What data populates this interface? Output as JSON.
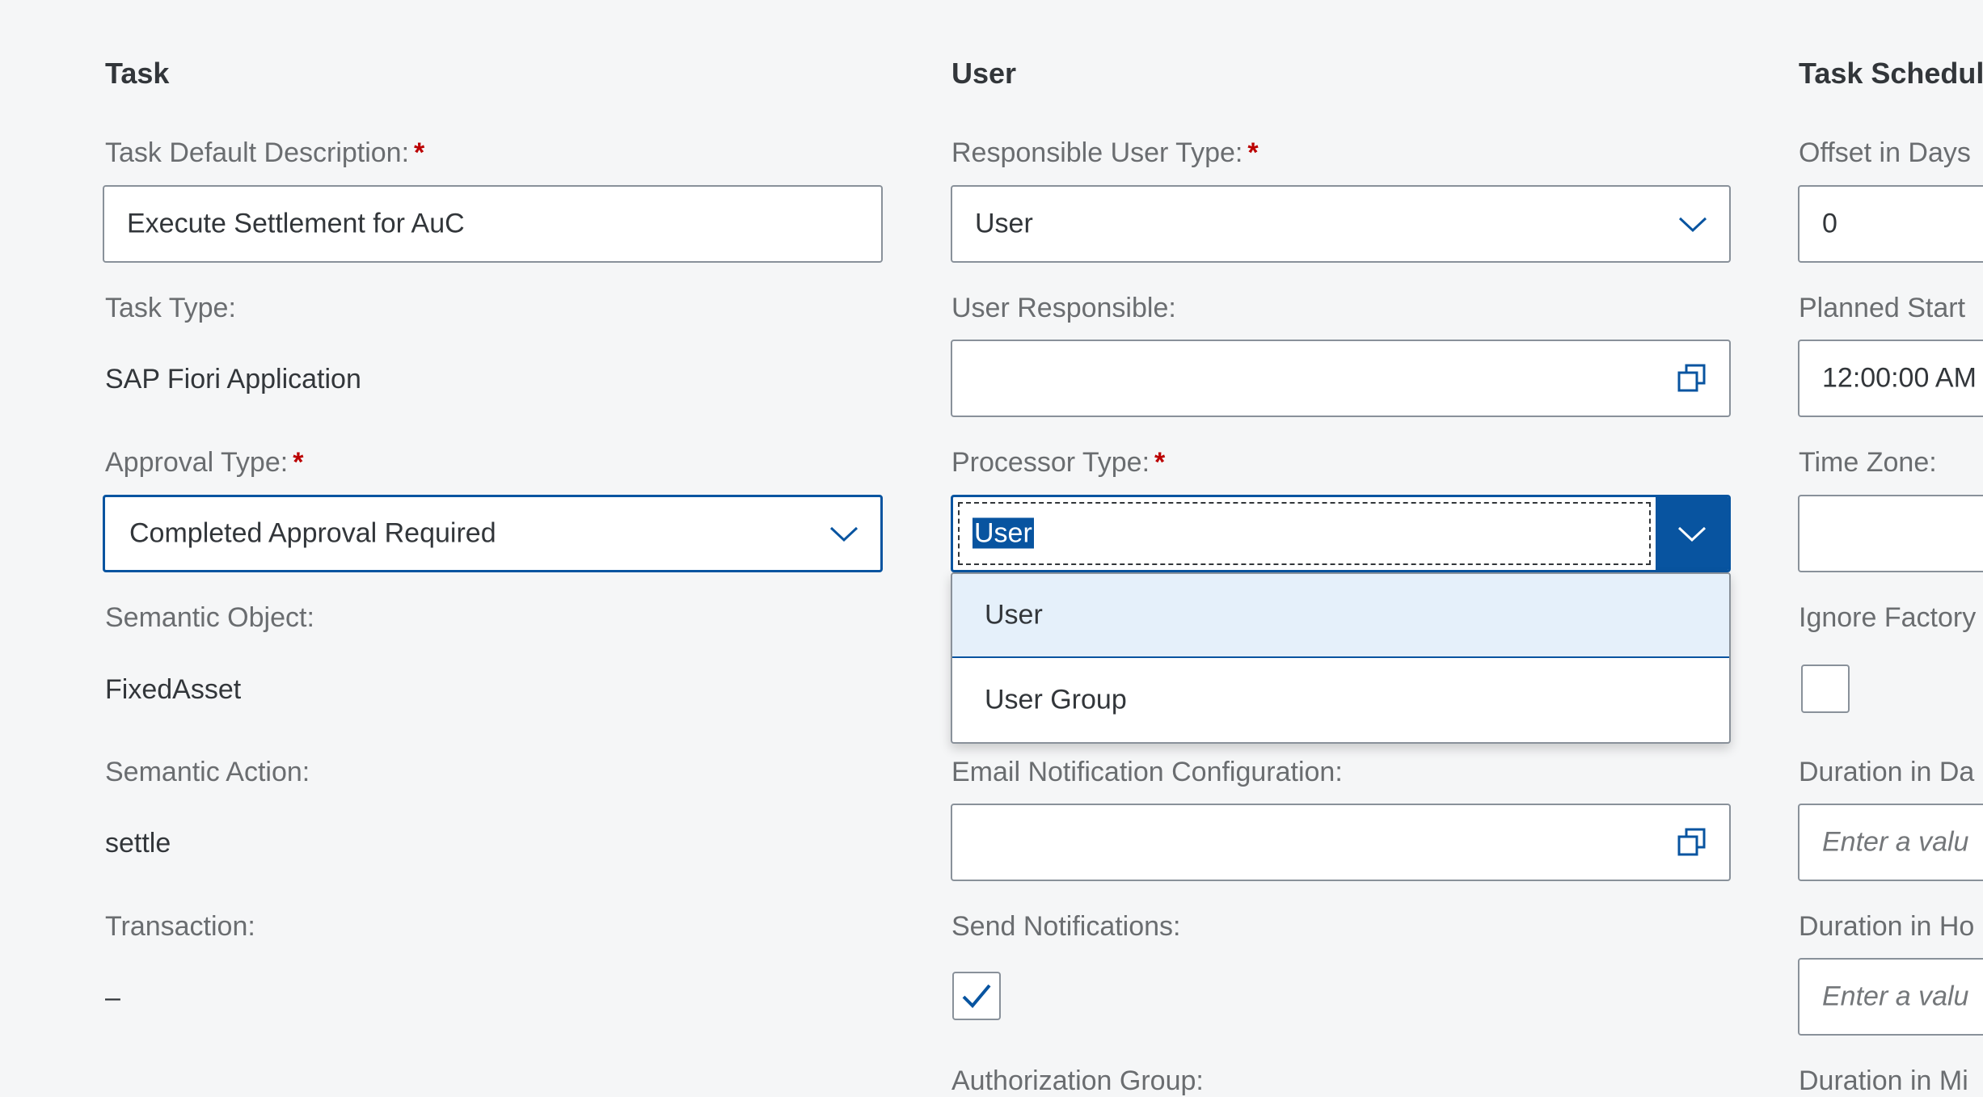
{
  "task_column": {
    "title": "Task",
    "default_description_label": "Task Default Description:",
    "default_description_value": "Execute Settlement for AuC",
    "task_type_label": "Task Type:",
    "task_type_value": "SAP Fiori Application",
    "approval_type_label": "Approval Type:",
    "approval_type_value": "Completed Approval Required",
    "semantic_object_label": "Semantic Object:",
    "semantic_object_value": "FixedAsset",
    "semantic_action_label": "Semantic Action:",
    "semantic_action_value": "settle",
    "transaction_label": "Transaction:",
    "transaction_value": "–"
  },
  "user_column": {
    "title": "User",
    "responsible_user_type_label": "Responsible User Type:",
    "responsible_user_type_value": "User",
    "user_responsible_label": "User Responsible:",
    "user_responsible_value": "",
    "processor_type_label": "Processor Type:",
    "processor_type_value": "User",
    "processor_type_options": [
      "User",
      "User Group"
    ],
    "email_notification_label": "Email Notification Configuration:",
    "email_notification_value": "",
    "send_notifications_label": "Send Notifications:",
    "send_notifications_checked": true,
    "authorization_group_label": "Authorization Group:"
  },
  "schedule_column": {
    "title": "Task Schedul",
    "offset_label": "Offset in Days",
    "offset_value": "0",
    "planned_start_label": "Planned Start",
    "planned_start_value": "12:00:00 AM",
    "time_zone_label": "Time Zone:",
    "time_zone_value": "",
    "ignore_factory_label": "Ignore Factory",
    "ignore_factory_checked": false,
    "duration_days_label": "Duration in Da",
    "duration_days_placeholder": "Enter a valu",
    "duration_hours_label": "Duration in Ho",
    "duration_hours_placeholder": "Enter a valu",
    "duration_minutes_label": "Duration in Mi"
  },
  "required_marker": "*",
  "colors": {
    "accent": "#0854a0",
    "required": "#bb0000",
    "background": "#f5f6f7",
    "hover_item": "#e5f0fa"
  },
  "icons": {
    "dropdown": "chevron-down-icon",
    "value_help": "value-help-icon",
    "check": "checkmark-icon"
  }
}
